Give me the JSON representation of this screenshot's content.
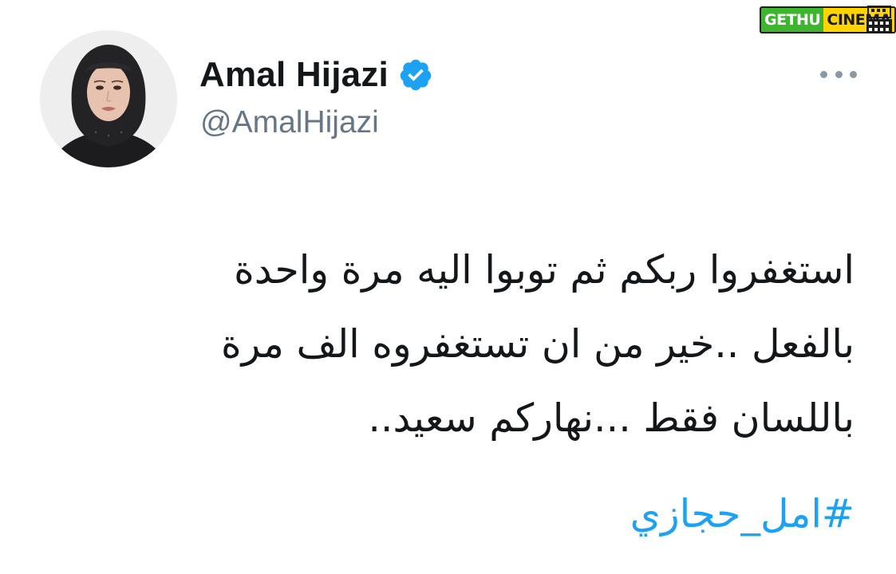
{
  "watermark": {
    "left_text": "GETHU",
    "right_text": "CINEMA",
    "icon": "film-reel-icon",
    "colors": {
      "green": "#3db52f",
      "yellow": "#ffd400"
    }
  },
  "tweet": {
    "avatar_icon": "profile-photo",
    "display_name": "Amal Hijazi",
    "verified_icon": "verified-badge-icon",
    "handle": "@AmalHijazi",
    "more_icon": "more-options-icon",
    "text_lines": [
      "استغفروا ربكم ثم توبوا اليه مرة واحدة",
      "بالفعل ..خير من ان تستغفروه الف مرة",
      "باللسان فقط ...نهاركم سعيد.."
    ],
    "hashtag": "#امل_حجازي"
  },
  "colors": {
    "text": "#14171a",
    "handle": "#657786",
    "link": "#1da1f2",
    "verified": "#1da1f2"
  }
}
